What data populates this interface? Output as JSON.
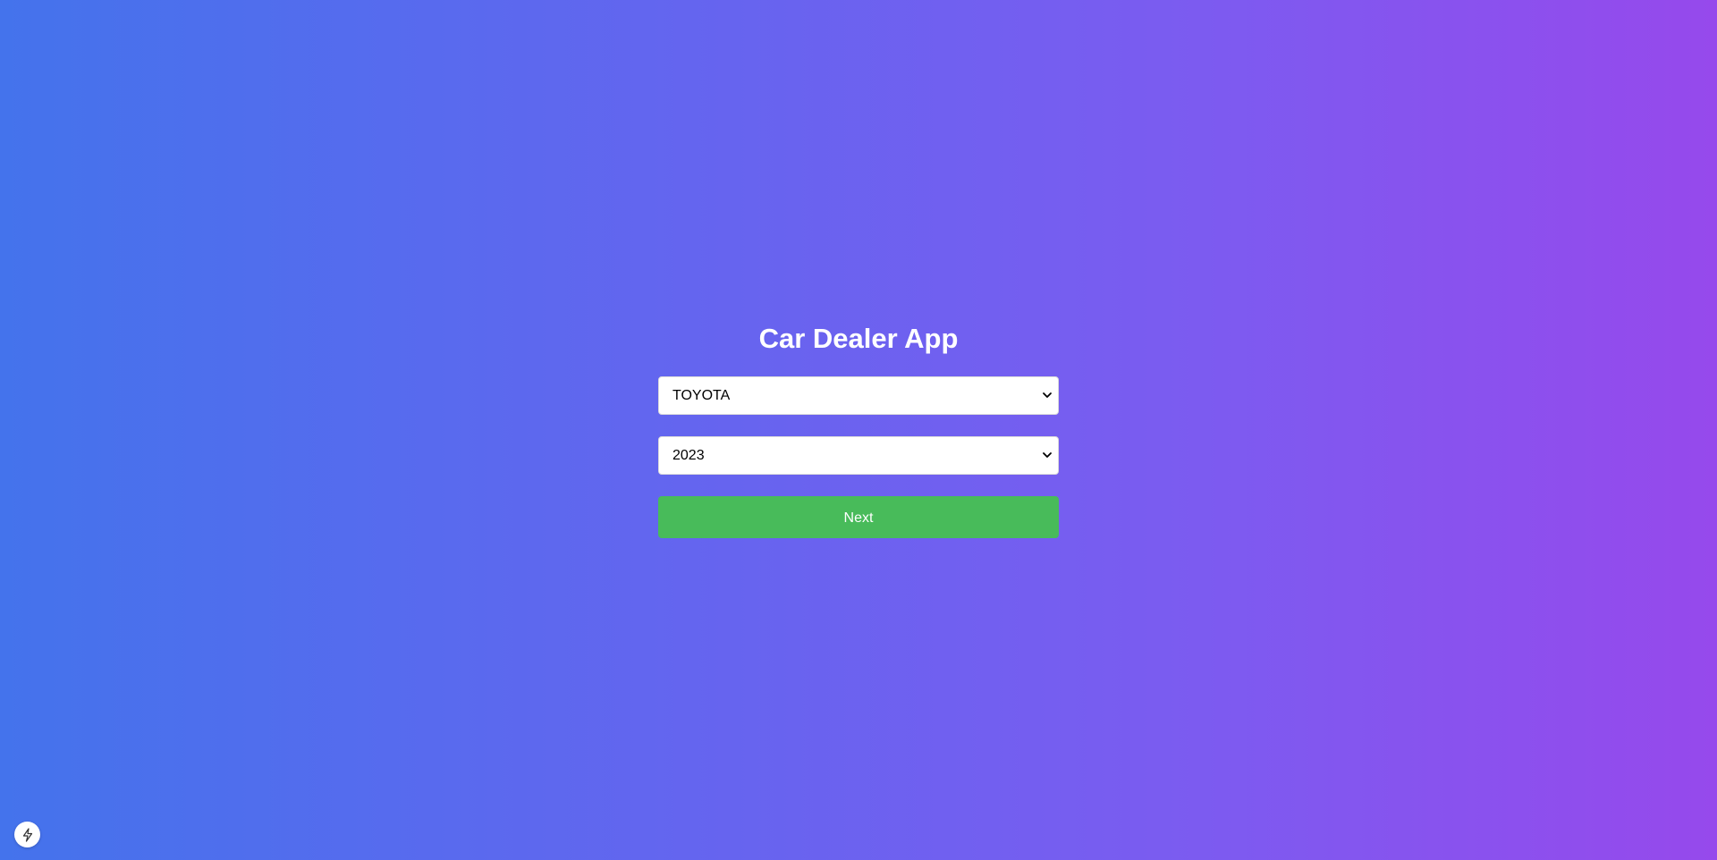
{
  "app": {
    "title": "Car Dealer App"
  },
  "form": {
    "make_select": {
      "selected": "TOYOTA"
    },
    "year_select": {
      "selected": "2023"
    },
    "next_label": "Next"
  },
  "colors": {
    "gradient_start": "#4473ec",
    "gradient_end": "#9649ec",
    "next_button": "#48bb5a",
    "title_text": "#ffffff"
  },
  "icons": {
    "select_arrow": "chevron-down-icon",
    "corner_badge": "lightning-bolt-icon"
  }
}
